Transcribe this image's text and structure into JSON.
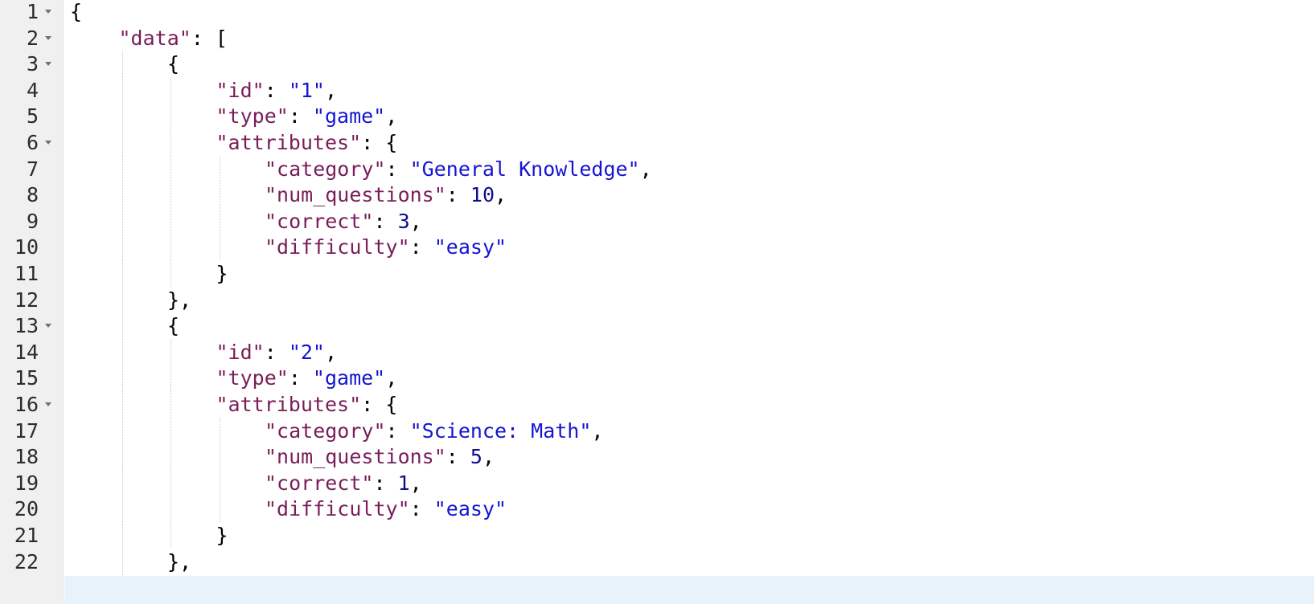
{
  "editor": {
    "colors": {
      "key": "#7a1d5a",
      "string": "#1414d2",
      "number": "#0e0e8f",
      "punctuation": "#000000",
      "gutter_bg": "#f0f0f0",
      "active_line": "#e8f2fb"
    },
    "lines": [
      {
        "n": "1",
        "fold": true,
        "indent": 0,
        "tokens": [
          {
            "t": "pun",
            "v": "{"
          }
        ]
      },
      {
        "n": "2",
        "fold": true,
        "indent": 1,
        "tokens": [
          {
            "t": "key",
            "v": "\"data\""
          },
          {
            "t": "pun",
            "v": ": ["
          }
        ]
      },
      {
        "n": "3",
        "fold": true,
        "indent": 2,
        "tokens": [
          {
            "t": "pun",
            "v": "{"
          }
        ]
      },
      {
        "n": "4",
        "fold": false,
        "indent": 3,
        "tokens": [
          {
            "t": "key",
            "v": "\"id\""
          },
          {
            "t": "pun",
            "v": ": "
          },
          {
            "t": "str",
            "v": "\"1\""
          },
          {
            "t": "pun",
            "v": ","
          }
        ]
      },
      {
        "n": "5",
        "fold": false,
        "indent": 3,
        "tokens": [
          {
            "t": "key",
            "v": "\"type\""
          },
          {
            "t": "pun",
            "v": ": "
          },
          {
            "t": "str",
            "v": "\"game\""
          },
          {
            "t": "pun",
            "v": ","
          }
        ]
      },
      {
        "n": "6",
        "fold": true,
        "indent": 3,
        "tokens": [
          {
            "t": "key",
            "v": "\"attributes\""
          },
          {
            "t": "pun",
            "v": ": {"
          }
        ]
      },
      {
        "n": "7",
        "fold": false,
        "indent": 4,
        "tokens": [
          {
            "t": "key",
            "v": "\"category\""
          },
          {
            "t": "pun",
            "v": ": "
          },
          {
            "t": "str",
            "v": "\"General Knowledge\""
          },
          {
            "t": "pun",
            "v": ","
          }
        ]
      },
      {
        "n": "8",
        "fold": false,
        "indent": 4,
        "tokens": [
          {
            "t": "key",
            "v": "\"num_questions\""
          },
          {
            "t": "pun",
            "v": ": "
          },
          {
            "t": "num",
            "v": "10"
          },
          {
            "t": "pun",
            "v": ","
          }
        ]
      },
      {
        "n": "9",
        "fold": false,
        "indent": 4,
        "tokens": [
          {
            "t": "key",
            "v": "\"correct\""
          },
          {
            "t": "pun",
            "v": ": "
          },
          {
            "t": "num",
            "v": "3"
          },
          {
            "t": "pun",
            "v": ","
          }
        ]
      },
      {
        "n": "10",
        "fold": false,
        "indent": 4,
        "tokens": [
          {
            "t": "key",
            "v": "\"difficulty\""
          },
          {
            "t": "pun",
            "v": ": "
          },
          {
            "t": "str",
            "v": "\"easy\""
          }
        ]
      },
      {
        "n": "11",
        "fold": false,
        "indent": 3,
        "tokens": [
          {
            "t": "pun",
            "v": "}"
          }
        ]
      },
      {
        "n": "12",
        "fold": false,
        "indent": 2,
        "tokens": [
          {
            "t": "pun",
            "v": "},"
          }
        ]
      },
      {
        "n": "13",
        "fold": true,
        "indent": 2,
        "tokens": [
          {
            "t": "pun",
            "v": "{"
          }
        ]
      },
      {
        "n": "14",
        "fold": false,
        "indent": 3,
        "tokens": [
          {
            "t": "key",
            "v": "\"id\""
          },
          {
            "t": "pun",
            "v": ": "
          },
          {
            "t": "str",
            "v": "\"2\""
          },
          {
            "t": "pun",
            "v": ","
          }
        ]
      },
      {
        "n": "15",
        "fold": false,
        "indent": 3,
        "tokens": [
          {
            "t": "key",
            "v": "\"type\""
          },
          {
            "t": "pun",
            "v": ": "
          },
          {
            "t": "str",
            "v": "\"game\""
          },
          {
            "t": "pun",
            "v": ","
          }
        ]
      },
      {
        "n": "16",
        "fold": true,
        "indent": 3,
        "tokens": [
          {
            "t": "key",
            "v": "\"attributes\""
          },
          {
            "t": "pun",
            "v": ": {"
          }
        ]
      },
      {
        "n": "17",
        "fold": false,
        "indent": 4,
        "tokens": [
          {
            "t": "key",
            "v": "\"category\""
          },
          {
            "t": "pun",
            "v": ": "
          },
          {
            "t": "str",
            "v": "\"Science: Math\""
          },
          {
            "t": "pun",
            "v": ","
          }
        ]
      },
      {
        "n": "18",
        "fold": false,
        "indent": 4,
        "tokens": [
          {
            "t": "key",
            "v": "\"num_questions\""
          },
          {
            "t": "pun",
            "v": ": "
          },
          {
            "t": "num",
            "v": "5"
          },
          {
            "t": "pun",
            "v": ","
          }
        ]
      },
      {
        "n": "19",
        "fold": false,
        "indent": 4,
        "tokens": [
          {
            "t": "key",
            "v": "\"correct\""
          },
          {
            "t": "pun",
            "v": ": "
          },
          {
            "t": "num",
            "v": "1"
          },
          {
            "t": "pun",
            "v": ","
          }
        ]
      },
      {
        "n": "20",
        "fold": false,
        "indent": 4,
        "tokens": [
          {
            "t": "key",
            "v": "\"difficulty\""
          },
          {
            "t": "pun",
            "v": ": "
          },
          {
            "t": "str",
            "v": "\"easy\""
          }
        ]
      },
      {
        "n": "21",
        "fold": false,
        "indent": 3,
        "tokens": [
          {
            "t": "pun",
            "v": "}"
          }
        ]
      },
      {
        "n": "22",
        "fold": false,
        "indent": 2,
        "tokens": [
          {
            "t": "pun",
            "v": "},"
          }
        ]
      }
    ]
  }
}
